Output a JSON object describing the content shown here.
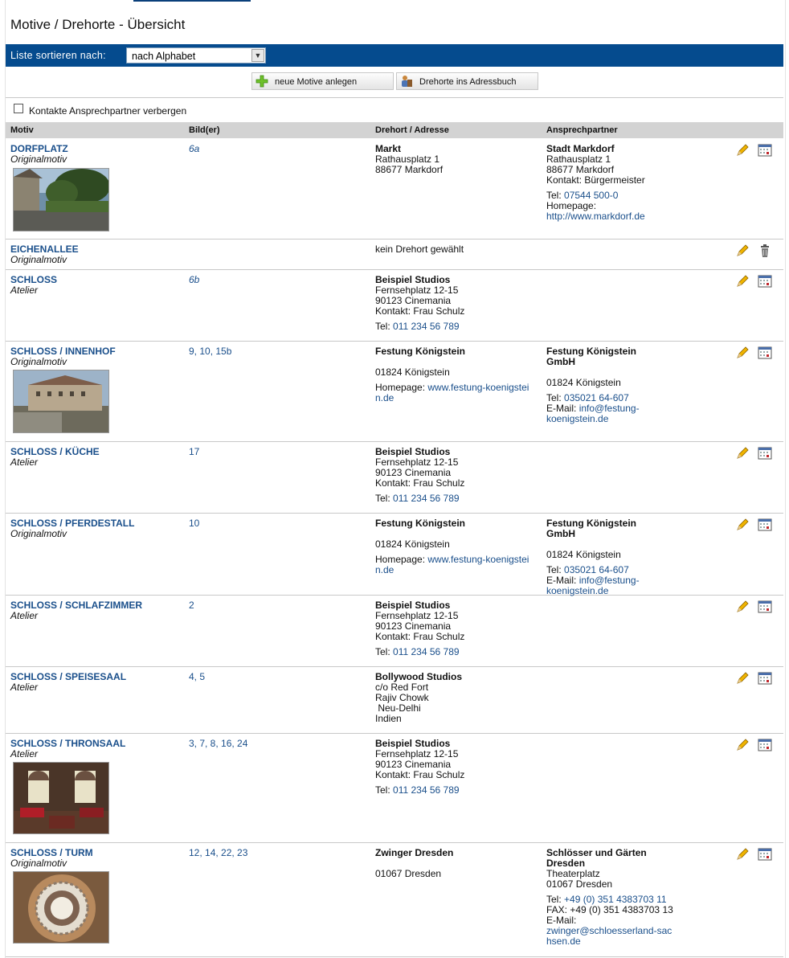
{
  "page": {
    "title": "Motive / Drehorte - Übersicht"
  },
  "sort": {
    "label": "Liste sortieren nach:",
    "value": "nach Alphabet"
  },
  "buttons": {
    "new_motive": "neue  Motive  anlegen",
    "addressbook": "Drehorte  ins  Adressbuch"
  },
  "checkbox": {
    "label": "Kontakte Ansprechpartner verbergen",
    "checked": false
  },
  "columns": {
    "motiv": "Motiv",
    "bild": "Bild(er)",
    "drehort": "Drehort / Adresse",
    "ansprech": "Ansprechpartner"
  },
  "rows": [
    {
      "name": "DORFPLATZ",
      "type": "Originalmotiv",
      "bilder": "6a",
      "photo": "village-square",
      "drehort": {
        "name": "Markt",
        "lines": [
          "Rathausplatz 1",
          "88677 Markdorf"
        ],
        "extra": []
      },
      "ansprech": {
        "name": "Stadt Markdorf",
        "lines": [
          "Rathausplatz 1",
          "88677 Markdorf",
          "Kontakt: Bürgermeister"
        ],
        "tel_label": "Tel:",
        "tel": "07544 500-0",
        "home_label": "Homepage:",
        "home": "http://www.markdorf.de"
      },
      "action": "calendar-icon"
    },
    {
      "name": "EICHENALLEE",
      "type": "Originalmotiv",
      "bilder": "",
      "drehort": {
        "name": "",
        "lines": [
          "kein Drehort gewählt"
        ]
      },
      "action": "trash-icon"
    },
    {
      "name": "SCHLOSS",
      "type": "Atelier",
      "bilder": "6b",
      "drehort": {
        "name": "Beispiel Studios",
        "lines": [
          "Fernsehplatz 12-15",
          "90123 Cinemania",
          "Kontakt: Frau Schulz"
        ],
        "tel_label": "Tel:",
        "tel": "011 234 56 789"
      },
      "action": "calendar-icon"
    },
    {
      "name": "SCHLOSS / INNENHOF",
      "type": "Originalmotiv",
      "bilder": "9, 10, 15b",
      "photo": "castle-courtyard",
      "drehort": {
        "name": "Festung Königstein",
        "lines": [
          "",
          "01824 Königstein"
        ],
        "home_label": "Homepage:",
        "home": "www.festung-koenigstein.de"
      },
      "ansprech": {
        "name": "Festung Königstein GmbH",
        "lines": [
          "",
          "01824 Königstein"
        ],
        "tel_label": "Tel:",
        "tel": "035021 64-607",
        "mail_label": "E-Mail:",
        "mail": "info@festung-koenigstein.de"
      },
      "action": "calendar-icon"
    },
    {
      "name": "SCHLOSS / KÜCHE",
      "type": "Atelier",
      "bilder": "17",
      "drehort": {
        "name": "Beispiel Studios",
        "lines": [
          "Fernsehplatz 12-15",
          "90123 Cinemania",
          "Kontakt: Frau Schulz"
        ],
        "tel_label": "Tel:",
        "tel": "011 234 56 789"
      },
      "action": "calendar-icon"
    },
    {
      "name": "SCHLOSS / PFERDESTALL",
      "type": "Originalmotiv",
      "bilder": "10",
      "drehort": {
        "name": "Festung Königstein",
        "lines": [
          "",
          "01824 Königstein"
        ],
        "home_label": "Homepage:",
        "home": "www.festung-koenigstein.de"
      },
      "ansprech": {
        "name": "Festung Königstein GmbH",
        "lines": [
          "",
          "01824 Königstein"
        ],
        "tel_label": "Tel:",
        "tel": "035021 64-607",
        "mail_label": "E-Mail:",
        "mail": "info@festung-koenigstein.de"
      },
      "action": "calendar-icon"
    },
    {
      "name": "SCHLOSS / SCHLAFZIMMER",
      "type": "Atelier",
      "bilder": "2",
      "drehort": {
        "name": "Beispiel Studios",
        "lines": [
          "Fernsehplatz 12-15",
          "90123 Cinemania",
          "Kontakt: Frau Schulz"
        ],
        "tel_label": "Tel:",
        "tel": "011 234 56 789"
      },
      "action": "calendar-icon"
    },
    {
      "name": "SCHLOSS / SPEISESAAL",
      "type": "Atelier",
      "bilder": "4, 5",
      "drehort": {
        "name": "Bollywood Studios",
        "lines": [
          "c/o Red Fort",
          "Rajiv Chowk",
          " Neu-Delhi",
          "Indien"
        ]
      },
      "action": "calendar-icon"
    },
    {
      "name": "SCHLOSS / THRONSAAL",
      "type": "Atelier",
      "bilder": "3, 7, 8, 16, 24",
      "photo": "throne-hall",
      "drehort": {
        "name": "Beispiel Studios",
        "lines": [
          "Fernsehplatz 12-15",
          "90123 Cinemania",
          "Kontakt: Frau Schulz"
        ],
        "tel_label": "Tel:",
        "tel": "011 234 56 789"
      },
      "action": "calendar-icon"
    },
    {
      "name": "SCHLOSS / TURM",
      "type": "Originalmotiv",
      "bilder": "12, 14, 22, 23",
      "photo": "tower-dome",
      "drehort": {
        "name": "Zwinger Dresden",
        "lines": [
          "",
          "01067 Dresden"
        ]
      },
      "ansprech": {
        "name": "Schlösser und Gärten Dresden",
        "lines": [
          "Theaterplatz",
          "01067 Dresden"
        ],
        "tel_label": "Tel:",
        "tel": "+49 (0) 351 4383703 11",
        "fax": "FAX: +49 (0) 351 4383703 13",
        "mail_label": "E-Mail:",
        "mail": "zwinger@schloesserland-sachsen.de"
      },
      "action": "calendar-icon"
    }
  ],
  "colors": {
    "header_bar": "#054b8e",
    "link": "#1a4f8b",
    "table_head": "#d3d3d3"
  }
}
